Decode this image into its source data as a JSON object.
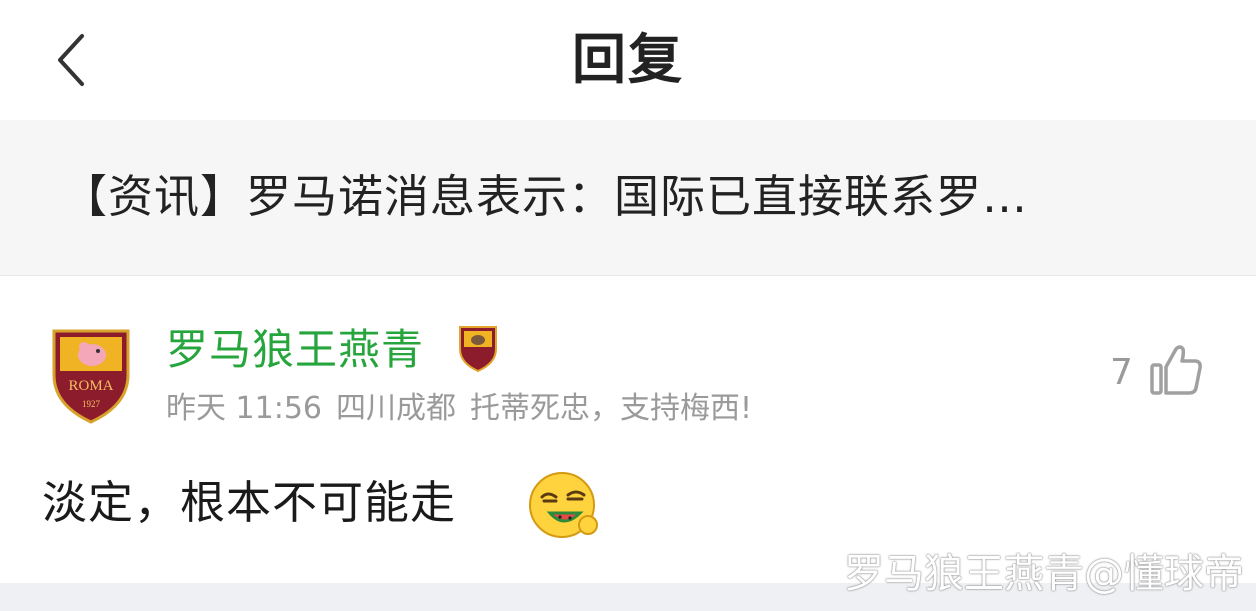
{
  "header": {
    "back_icon": "chevron-left-icon",
    "title": "回复"
  },
  "article": {
    "title": "【资讯】罗马诺消息表示：国际已直接联系罗…"
  },
  "comment": {
    "username": "罗马狼王燕青",
    "username_color": "#27a53d",
    "avatar_icon": "as-roma-crest-icon",
    "avatar_text": "ROMA",
    "avatar_year": "1927",
    "badge_icon": "as-roma-badge-icon",
    "time": "昨天 11:56",
    "location": "四川成都",
    "signature": "托蒂死忠，支持梅西!",
    "likes": "7",
    "like_icon": "thumbs-up-icon",
    "text": "淡定，根本不可能走",
    "emoji_icon": "eating-watermelon-emoji"
  },
  "watermark": "罗马狼王燕青@懂球帝"
}
